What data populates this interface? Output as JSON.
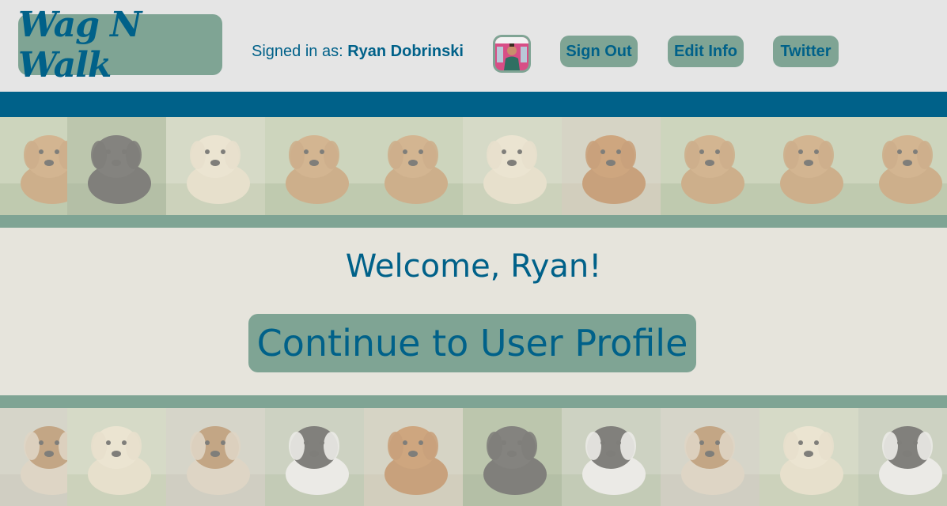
{
  "header": {
    "logo_text": "Wag N Walk",
    "signed_in_prefix": "Signed in as:",
    "user_name": "Ryan Dobrinski",
    "nav": {
      "sign_out": "Sign Out",
      "edit_info": "Edit Info",
      "twitter": "Twitter"
    }
  },
  "main": {
    "welcome": "Welcome, Ryan!",
    "continue_label": "Continue to User Profile"
  },
  "colors": {
    "brand_blue": "#006189",
    "sage_green": "#7fa494",
    "header_bg": "#e5e5e5",
    "page_bg": "#e6e4dc"
  },
  "strips": {
    "top": [
      "golden-retriever-running",
      "black-lab",
      "golden-puppy",
      "golden-retriever-running",
      "golden-retriever-running",
      "golden-puppy",
      "golden-retriever",
      "golden-retriever-running",
      "golden-retriever-running",
      "golden-retriever-running"
    ],
    "bottom": [
      "beagle",
      "golden-puppy",
      "beagle",
      "husky",
      "golden-retriever",
      "black-lab",
      "husky",
      "beagle",
      "golden-puppy",
      "husky"
    ]
  }
}
